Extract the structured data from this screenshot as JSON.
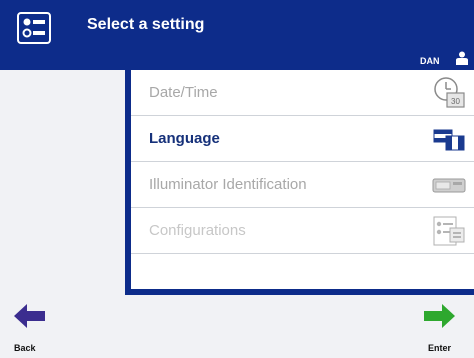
{
  "header": {
    "title": "Select a setting",
    "user": "DAN",
    "icon": "settings-list-icon"
  },
  "menu": {
    "items": [
      {
        "label": "Date/Time",
        "state": "disabled",
        "icon": "clock-calendar-icon"
      },
      {
        "label": "Language",
        "state": "enabled",
        "icon": "language-flags-icon"
      },
      {
        "label": "Illuminator Identification",
        "state": "disabled",
        "icon": "illuminator-device-icon"
      },
      {
        "label": "Configurations",
        "state": "disabled",
        "icon": "configuration-list-icon"
      }
    ]
  },
  "footer": {
    "back_label": "Back",
    "enter_label": "Enter"
  },
  "colors": {
    "header_bg": "#0d2c8a",
    "back_arrow": "#3b2d8f",
    "enter_arrow": "#2ea82e",
    "active_text": "#16317a"
  }
}
